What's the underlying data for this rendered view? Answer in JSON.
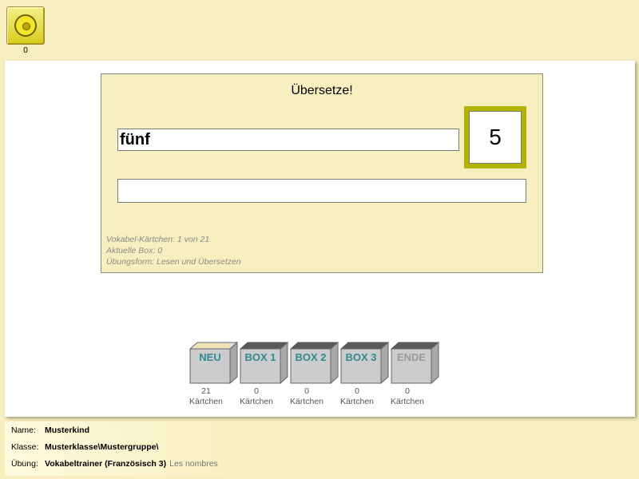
{
  "coins": {
    "count": "0",
    "icon": "coin-icon"
  },
  "card": {
    "title": "Übersetze!",
    "word": "fünf",
    "number": "5",
    "answer_value": "",
    "info": [
      "Vokabel-Kärtchen: 1 von 21",
      "Aktuelle Box: 0",
      "Übungsform: Lesen und Übersetzen"
    ]
  },
  "boxes": [
    {
      "label": "NEU",
      "count": "21",
      "unit": "Kärtchen"
    },
    {
      "label": "BOX 1",
      "count": "0",
      "unit": "Kärtchen"
    },
    {
      "label": "BOX 2",
      "count": "0",
      "unit": "Kärtchen"
    },
    {
      "label": "BOX 3",
      "count": "0",
      "unit": "Kärtchen"
    },
    {
      "label": "ENDE",
      "count": "0",
      "unit": "Kärtchen"
    }
  ],
  "footer": {
    "name_label": "Name:",
    "name_value": "Musterkind",
    "class_label": "Klasse:",
    "class_value": "Musterklasse\\Mustergruppe\\",
    "exercise_label": "Übung:",
    "exercise_value": "Vokabeltrainer (Französisch 3)",
    "exercise_extra": "Les nombres"
  },
  "colors": {
    "accent": "#b3b300",
    "background": "#f7efbf",
    "box_label": "#2f8a92"
  }
}
